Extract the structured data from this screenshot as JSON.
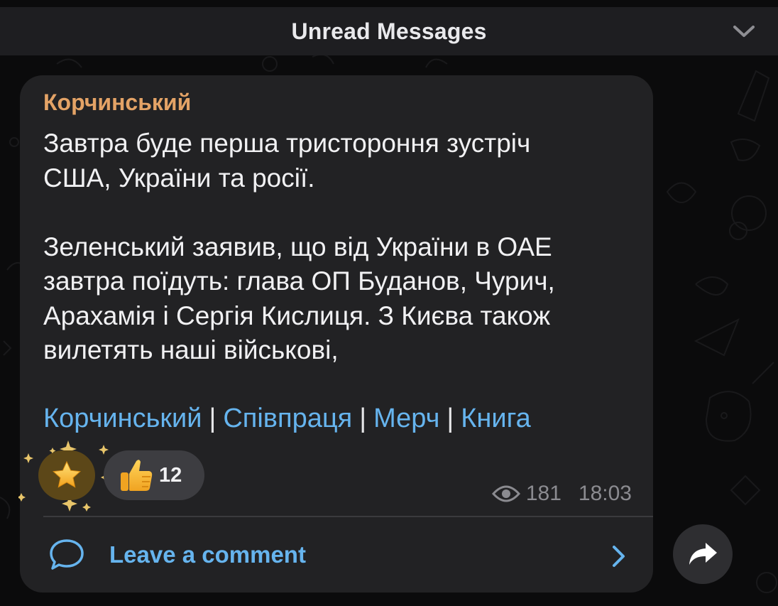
{
  "header": {
    "title": "Unread Messages",
    "collapse_icon": "chevron-down-icon"
  },
  "message": {
    "sender": "Корчинський",
    "sender_color": "#e4a366",
    "lines_p1": [
      "Завтра буде перша тристороння зустріч",
      "США, України та росії."
    ],
    "lines_p2": [
      "Зеленський заявив, що від України в ОАЕ",
      "завтра поїдуть: глава ОП Буданов, Чурич,",
      "Арахамія і Сергія Кислиця. З Києва також",
      "вилетять наші військові,"
    ],
    "links": [
      "Корчинський",
      "Співпраця",
      "Мерч",
      "Книга"
    ],
    "link_separator": "|",
    "link_color": "#66b4ee"
  },
  "reactions": [
    {
      "icon": "star-icon",
      "count": ""
    },
    {
      "icon": "thumbs-up-icon",
      "count": "12"
    }
  ],
  "meta": {
    "views_icon": "eye-icon",
    "views": "181",
    "time": "18:03"
  },
  "comments": {
    "label": "Leave a comment",
    "icon": "comment-bubble-icon",
    "chevron": "chevron-right-icon"
  },
  "share": {
    "icon": "share-arrow-icon"
  }
}
